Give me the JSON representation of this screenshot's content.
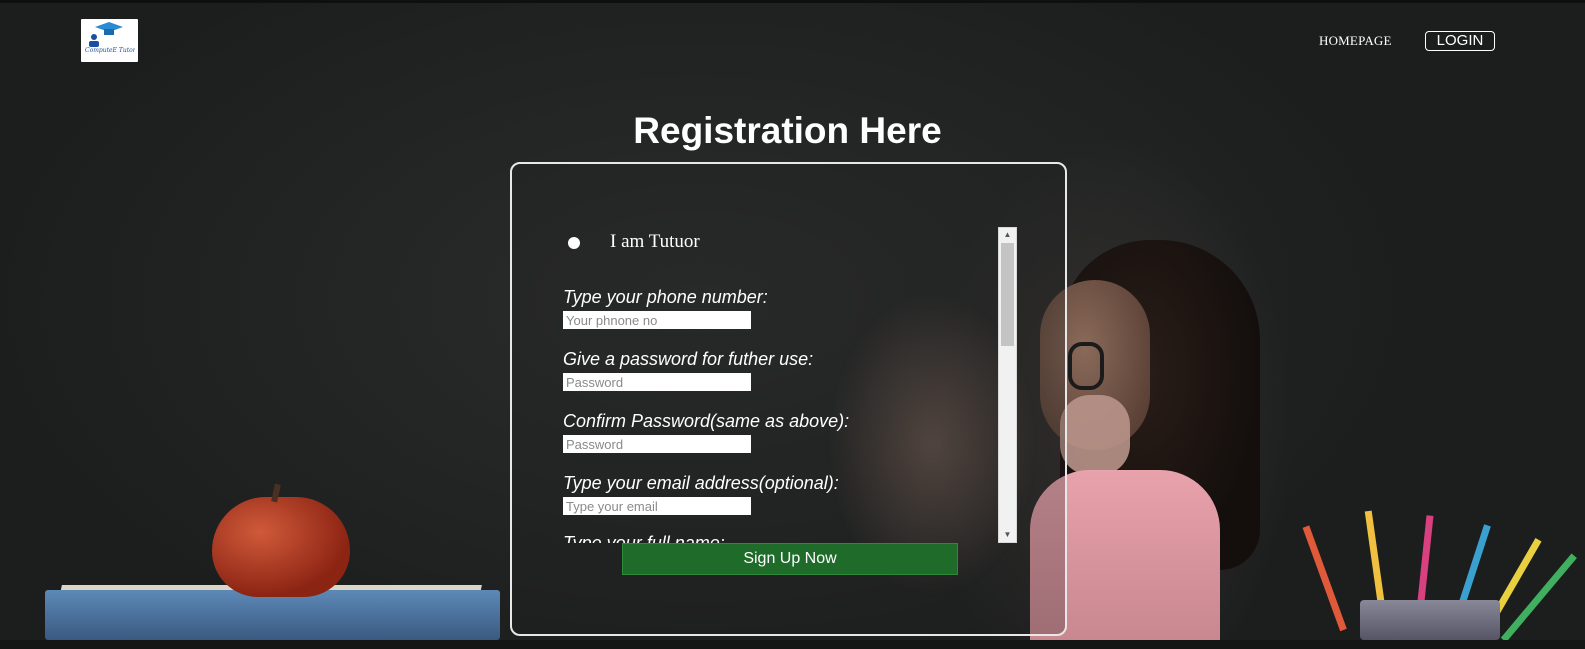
{
  "header": {
    "logo_text": "ComputeE Tutor",
    "nav_home": "HOMEPAGE",
    "nav_login": "LOGIN"
  },
  "page": {
    "title": "Registration Here"
  },
  "form": {
    "radio_label": "I am Tutuor",
    "fields": [
      {
        "label": "Type your phone number:",
        "placeholder": "Your phnone no"
      },
      {
        "label": "Give a password for futher use:",
        "placeholder": "Password"
      },
      {
        "label": "Confirm Password(same as above):",
        "placeholder": "Password"
      },
      {
        "label": "Type your email address(optional):",
        "placeholder": "Type your email"
      },
      {
        "label": "Type your full name:"
      }
    ],
    "submit_label": "Sign Up Now"
  },
  "colors": {
    "submit_bg": "#1f6b2a",
    "background": "#1f2121"
  }
}
